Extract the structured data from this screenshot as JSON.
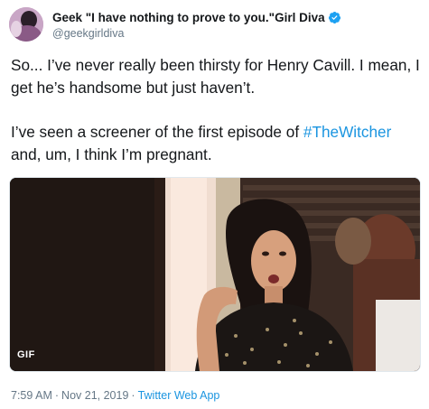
{
  "author": {
    "display_name": "Geek \"I have nothing to prove to you.\"Girl Diva",
    "handle": "@geekgirldiva",
    "verified_icon": "verified-badge-icon",
    "avatar_icon": "avatar"
  },
  "tweet": {
    "paragraph1": "So... I’ve never really been thirsty for Henry Cavill. I mean, I get he’s handsome but just haven’t.",
    "paragraph2_before": "I’ve seen a screener of the first episode of ",
    "hashtag": "#TheWitcher",
    "paragraph2_after": " and, um, I think I’m pregnant."
  },
  "media": {
    "type_badge": "GIF"
  },
  "meta": {
    "time": "7:59 AM",
    "separator1": "·",
    "date": "Nov 21, 2019",
    "separator2": "·",
    "source": "Twitter Web App"
  },
  "colors": {
    "link": "#1b95e0",
    "muted": "#657786",
    "text": "#14171a"
  }
}
